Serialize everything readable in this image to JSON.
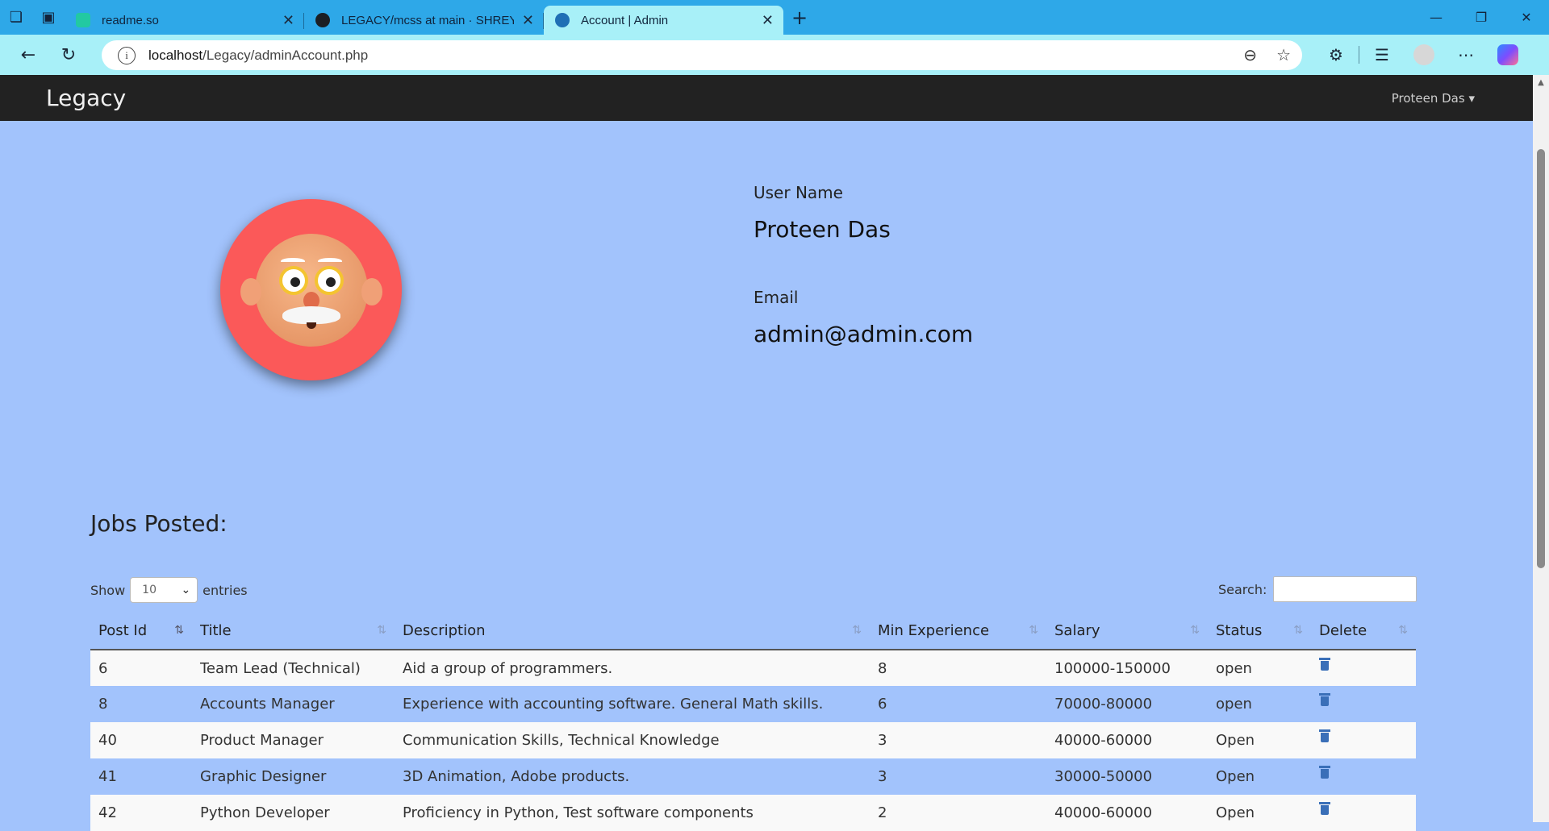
{
  "browser": {
    "tabs": [
      {
        "title": "readme.so",
        "favicon_color": "#22c9a2",
        "active": false
      },
      {
        "title": "LEGACY/mcss at main · SHREYANS",
        "favicon_color": "#1b1f24",
        "active": false
      },
      {
        "title": "Account | Admin",
        "favicon_color": "#1f6fb5",
        "active": true
      }
    ],
    "url_host": "localhost",
    "url_path": "/Legacy/adminAccount.php"
  },
  "site": {
    "brand": "Legacy",
    "user_menu": "Proteen Das"
  },
  "profile": {
    "username_label": "User Name",
    "username": "Proteen Das",
    "email_label": "Email",
    "email": "admin@admin.com"
  },
  "jobs": {
    "title": "Jobs Posted:",
    "show_label": "Show",
    "entries_value": "10",
    "entries_label": "entries",
    "search_label": "Search:",
    "columns": [
      "Post Id",
      "Title",
      "Description",
      "Min Experience",
      "Salary",
      "Status",
      "Delete"
    ],
    "rows": [
      {
        "id": "6",
        "title": "Team Lead (Technical)",
        "description": "Aid a group of programmers.",
        "min_exp": "8",
        "salary": "100000-150000",
        "status": "open"
      },
      {
        "id": "8",
        "title": "Accounts Manager",
        "description": "Experience with accounting software. General Math skills.",
        "min_exp": "6",
        "salary": "70000-80000",
        "status": "open"
      },
      {
        "id": "40",
        "title": "Product Manager",
        "description": "Communication Skills, Technical Knowledge",
        "min_exp": "3",
        "salary": "40000-60000",
        "status": "Open"
      },
      {
        "id": "41",
        "title": "Graphic Designer",
        "description": "3D Animation, Adobe products.",
        "min_exp": "3",
        "salary": "30000-50000",
        "status": "Open"
      },
      {
        "id": "42",
        "title": "Python Developer",
        "description": "Proficiency in Python, Test software components",
        "min_exp": "2",
        "salary": "40000-60000",
        "status": "Open"
      }
    ]
  }
}
